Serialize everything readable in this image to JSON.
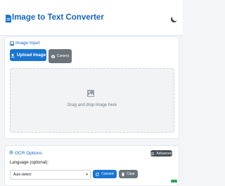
{
  "header": {
    "title": "Image to Text Converter",
    "theme_toggle_icon": "moon-icon"
  },
  "input_section": {
    "title": "Image Input",
    "upload_label": "Upload Image",
    "camera_label": "Camera",
    "dropzone_text": "Drag and drop image here"
  },
  "ocr_section": {
    "title": "OCR Options",
    "advanced_label": "Advanced",
    "language_label": "Language (optional):",
    "language_value": "Auto-detect",
    "convert_label": "Convert",
    "clear_label": "Clear"
  },
  "colors": {
    "primary": "#1976d2",
    "secondary": "#6c757d",
    "title": "#1565c0",
    "success": "#2e9e5b"
  }
}
